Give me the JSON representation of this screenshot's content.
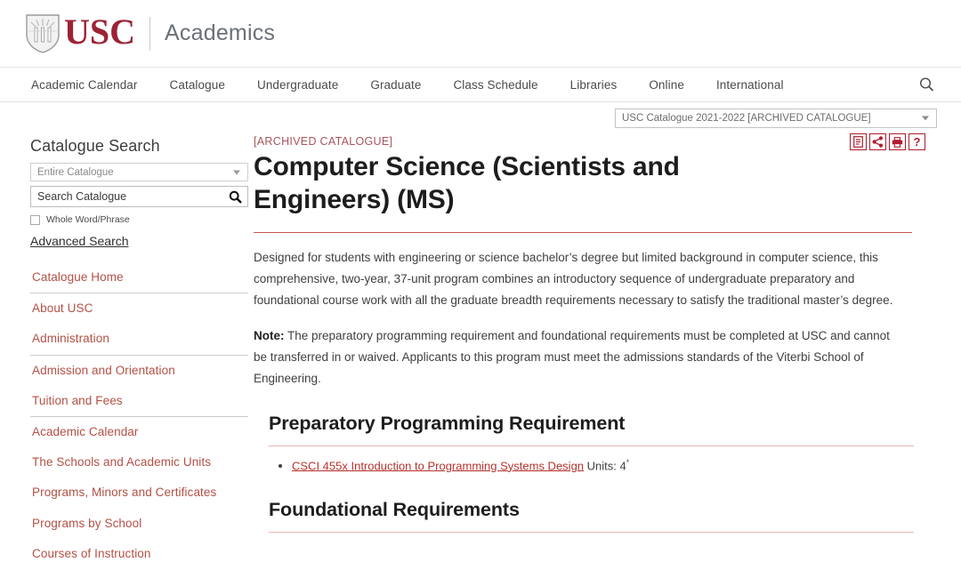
{
  "header": {
    "logo_word": "USC",
    "logo_sub": "Academics",
    "shield_icon": "usc-shield-icon"
  },
  "nav": {
    "items": [
      {
        "label": "Academic Calendar"
      },
      {
        "label": "Catalogue"
      },
      {
        "label": "Undergraduate"
      },
      {
        "label": "Graduate"
      },
      {
        "label": "Class Schedule"
      },
      {
        "label": "Libraries"
      },
      {
        "label": "Online"
      },
      {
        "label": "International"
      }
    ],
    "search_icon": "search-icon"
  },
  "catalogue_selector": {
    "value": "USC Catalogue 2021-2022 [ARCHIVED CATALOGUE]",
    "caret_icon": "chevron-down-icon"
  },
  "sidebar": {
    "title": "Catalogue Search",
    "scope": {
      "value": "Entire Catalogue",
      "caret_icon": "chevron-down-icon"
    },
    "search": {
      "placeholder": "Search Catalogue",
      "value": "",
      "button_icon": "search-icon"
    },
    "whole_word": {
      "label": "Whole Word/Phrase",
      "checked": false
    },
    "advanced_search": "Advanced Search",
    "items": [
      {
        "label": "Catalogue Home",
        "separator_after": true
      },
      {
        "label": "About USC",
        "separator_after": false
      },
      {
        "label": "Administration",
        "separator_after": true
      },
      {
        "label": "Admission and Orientation",
        "separator_after": false
      },
      {
        "label": "Tuition and Fees",
        "separator_after": true
      },
      {
        "label": "Academic Calendar",
        "separator_after": false
      },
      {
        "label": "The Schools and Academic Units",
        "separator_after": false
      },
      {
        "label": "Programs, Minors and Certificates",
        "separator_after": false
      },
      {
        "label": "Programs by School",
        "separator_after": false
      },
      {
        "label": "Courses of Instruction",
        "separator_after": false
      }
    ]
  },
  "main": {
    "archived_tag": "[ARCHIVED CATALOGUE]",
    "title": "Computer Science (Scientists and Engineers) (MS)",
    "tools": [
      {
        "icon": "print-degree-planner-icon",
        "glyph": "☰"
      },
      {
        "icon": "share-icon",
        "glyph": "⮩"
      },
      {
        "icon": "print-icon",
        "glyph": "⎙"
      },
      {
        "icon": "help-icon",
        "glyph": "?"
      }
    ],
    "intro_paragraph": "Designed for students with engineering or science bachelor’s degree but limited background in computer science, this comprehensive, two-year, 37-unit program combines an introductory sequence of undergraduate preparatory and foundational course work with all the graduate breadth requirements necessary to satisfy the traditional master’s degree.",
    "note_label": "Note:",
    "note_text": " The preparatory programming requirement and foundational requirements must be completed at USC and cannot be transferred in or waived. Applicants to this program must meet the admissions standards of the Viterbi School of Engineering.",
    "sections": [
      {
        "heading": "Preparatory Programming Requirement",
        "courses": [
          {
            "link": "CSCI 455x Introduction to Programming Systems Design",
            "units": " Units: 4",
            "asterisk": "*"
          }
        ]
      },
      {
        "heading": "Foundational Requirements",
        "courses": []
      }
    ]
  },
  "colors": {
    "usc_cardinal": "#9d2235",
    "link_red": "#b45045",
    "icon_red": "#b01c2e",
    "title_rule": "#c0392b"
  }
}
